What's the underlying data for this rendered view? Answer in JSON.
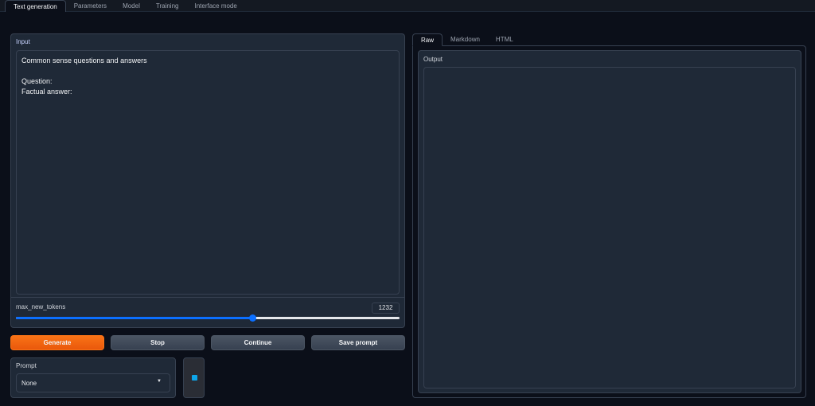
{
  "tabs": [
    {
      "label": "Text generation",
      "active": true
    },
    {
      "label": "Parameters"
    },
    {
      "label": "Model"
    },
    {
      "label": "Training"
    },
    {
      "label": "Interface mode"
    }
  ],
  "input": {
    "label": "Input",
    "value": "Common sense questions and answers\n\nQuestion:\nFactual answer:"
  },
  "max_new_tokens": {
    "label": "max_new_tokens",
    "value": "1232",
    "fraction": 0.616
  },
  "buttons": {
    "generate": "Generate",
    "stop": "Stop",
    "continue": "Continue",
    "save_prompt": "Save prompt"
  },
  "prompt": {
    "label": "Prompt",
    "selected": "None"
  },
  "output_tabs": [
    {
      "label": "Raw",
      "active": true
    },
    {
      "label": "Markdown"
    },
    {
      "label": "HTML"
    }
  ],
  "output": {
    "label": "Output",
    "value": ""
  }
}
